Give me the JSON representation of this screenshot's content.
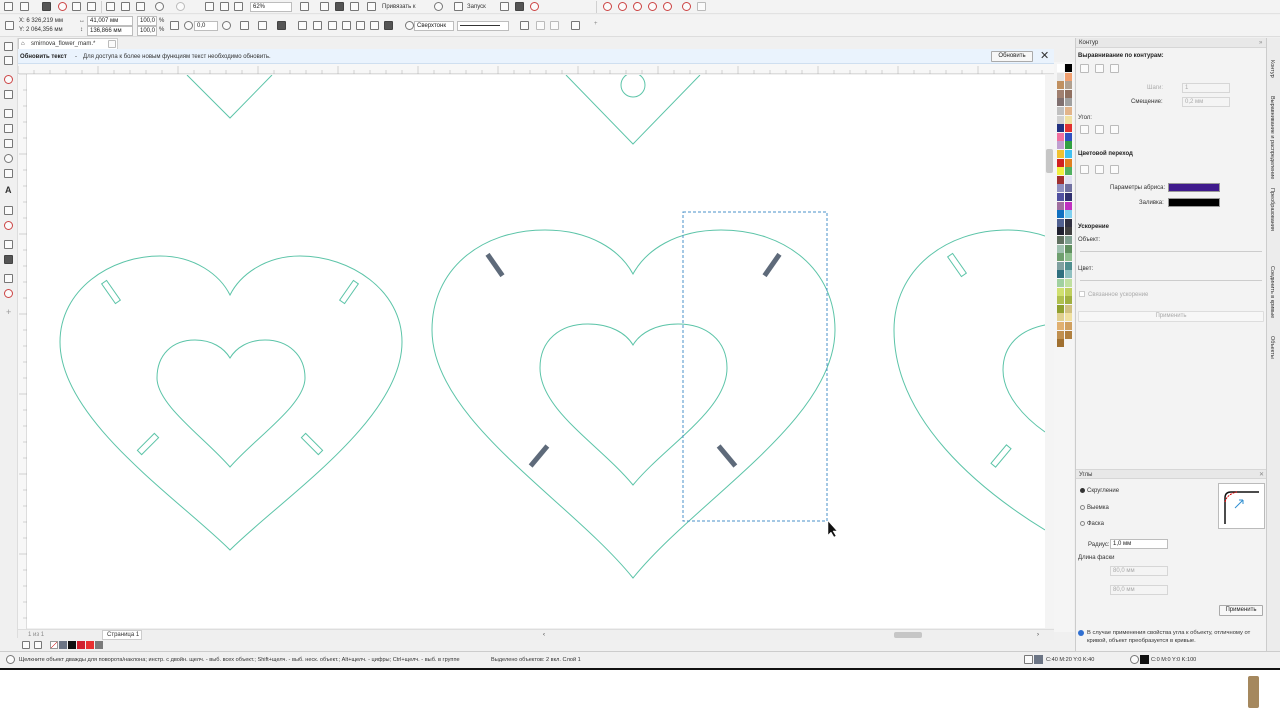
{
  "document": {
    "tab_name": "smirnova_flower_mam.*"
  },
  "notice": {
    "title": "Обновить текст",
    "separator": "-",
    "message": "Для доступа к более новым функциям текст необходимо обновить.",
    "button": "Обновить"
  },
  "toolbar": {
    "zoom": "62%",
    "snap_label": "Привязать к",
    "launch_label": "Запуск"
  },
  "propbar": {
    "x": "X: 6 326,219 мм",
    "y": "Y: 2 064,356 мм",
    "width": "41,007 мм",
    "height": "136,866 мм",
    "scale_x": "100,0",
    "scale_y": "100,0",
    "pct": "%",
    "angle": "0,0",
    "outline_width": "Сверхтонк"
  },
  "docker_contour": {
    "header": "Контур",
    "align_title": "Выравнивание по контурам:",
    "step_label": "Шаги:",
    "step_value": "1",
    "offset_label": "Смещение:",
    "offset_value": "0,2 мм",
    "angle_label": "Угол:",
    "color_blend_title": "Цветовой переход",
    "outline_params_label": "Параметры абриса:",
    "outline_color": "#3f1a8c",
    "fill_label": "Заливка:",
    "fill_color": "#000000",
    "accel_title": "Ускорение",
    "object_label": "Объект:",
    "color_label": "Цвет:",
    "link_accel_label": "Связанное ускорение",
    "apply_label": "Применить"
  },
  "docker_corners": {
    "header": "Углы",
    "rounding": "Скругление",
    "scallop": "Выемка",
    "chamfer": "Фаска",
    "radius_label": "Радиус:",
    "radius_value": "1,0 мм",
    "chamfer_length_label": "Длина фаски",
    "chamfer_a": "80,0 мм",
    "chamfer_b": "80,0 мм",
    "apply_label": "Применить",
    "info": "В случае применения свойства угла к объекту, отличному от кривой, объект преобразуется в кривые."
  },
  "side_tabs": [
    "Контур",
    "Выравнивание и распределение",
    "Преобразования",
    "Соединить в кривые",
    "Объекты"
  ],
  "page_nav": {
    "page_label": "Страница 1",
    "counts": "1 из 1"
  },
  "status": {
    "hint": "Щелкните объект дважды для поворота/наклона; инстр. с двойн. щелч. - выб. всех объект.; Shift+щелч. - выб. неск. объект.; Alt+щелч. - цифры; Ctrl+щелч. - выб. в группе",
    "selection": "Выделено объектов: 2 вкл. Слой 1",
    "fill_info": "C:40 M:20 Y:0 K:40",
    "outline_info": "C:0 M:0 Y:0 K:100"
  },
  "colors": {
    "shape_stroke": "#5cc4a8",
    "slot_fill": "#5e6a7a",
    "accent_blue": "#2f6fd1"
  },
  "palette": [
    "#ffffff",
    "#000000",
    "#e5e5e5",
    "#f0a070",
    "#c09060",
    "#b0a090",
    "#a08070",
    "#907060",
    "#807070",
    "#a0a0a0",
    "#c0c0c0",
    "#e2b48a",
    "#d0d0d0",
    "#f0e0a0",
    "#203080",
    "#e03030",
    "#f070a0",
    "#3050c0",
    "#c0a0d0",
    "#30a040",
    "#f0c030",
    "#40c0f0",
    "#d02020",
    "#e08020",
    "#f0f040",
    "#50b060",
    "#a03030",
    "#e0e0f0",
    "#9090c0",
    "#7070a0",
    "#5050a0",
    "#30306f",
    "#a070a0",
    "#c030c0",
    "#1070c0",
    "#7fd0f0",
    "#506090",
    "#303040",
    "#202030",
    "#404040",
    "#607060",
    "#80a090",
    "#a0c0b0",
    "#5f8f5f",
    "#6f9f6f",
    "#8fbf8f",
    "#7fa0a0",
    "#4f8f8f",
    "#2f6f7f",
    "#8fc0c0",
    "#a0d0a0",
    "#c0e0a0",
    "#d0e070",
    "#c0d060",
    "#b0c050",
    "#a0b040",
    "#90a030",
    "#d0c080",
    "#e0d090",
    "#f0e0a0",
    "#e0b070",
    "#d0a060",
    "#c09050",
    "#b08040",
    "#a07030"
  ]
}
